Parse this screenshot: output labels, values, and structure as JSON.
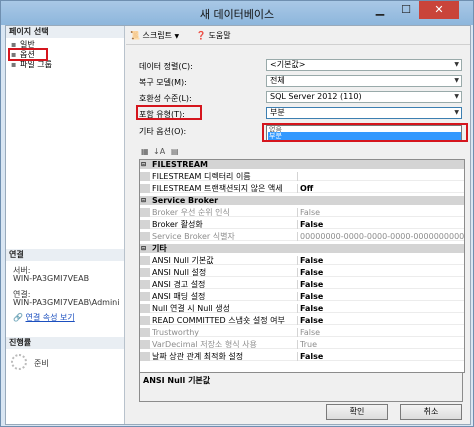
{
  "window": {
    "title": "새 데이터베이스"
  },
  "left_panel": {
    "pages_header": "페이지 선택",
    "pages": [
      {
        "label": "일반",
        "icon": "page-icon"
      },
      {
        "label": "옵션",
        "icon": "page-icon"
      },
      {
        "label": "파일 그룹",
        "icon": "page-icon"
      }
    ],
    "connection_header": "연결",
    "server_label": "서버:",
    "server_value": "WIN-PA3GMI7VEAB",
    "conn_label": "연결:",
    "conn_value": "WIN-PA3GMI7VEAB\\Admini",
    "conn_link": "연결 속성 보기",
    "progress_header": "진행률",
    "progress_status": "준비"
  },
  "toolbar": {
    "script_label": "스크립트",
    "help_label": "도움말"
  },
  "fields": [
    {
      "label": "데이터 정렬(C):",
      "value": "<기본값>"
    },
    {
      "label": "복구 모델(M):",
      "value": "전체"
    },
    {
      "label": "호환성 수준(L):",
      "value": "SQL Server 2012 (110)"
    },
    {
      "label": "포함 유형(T):",
      "value": "부분"
    },
    {
      "label": "기타 옵션(O):",
      "value": ""
    }
  ],
  "dropdown": {
    "options": [
      "없음",
      "부분"
    ],
    "selected": "부분"
  },
  "property_grid": {
    "rows": [
      {
        "type": "cat",
        "name": "FILESTREAM"
      },
      {
        "type": "prop",
        "name": "FILESTREAM 디렉터리 이름",
        "value": "",
        "disabled": false
      },
      {
        "type": "prop",
        "name": "FILESTREAM 트랜잭션되지 않은 액세",
        "value": "Off",
        "disabled": false
      },
      {
        "type": "cat",
        "name": "Service Broker"
      },
      {
        "type": "prop",
        "name": "Broker 우선 순위 인식",
        "value": "False",
        "disabled": true
      },
      {
        "type": "prop",
        "name": "Broker 활성화",
        "value": "False",
        "disabled": false
      },
      {
        "type": "prop",
        "name": "Service Broker 식별자",
        "value": "00000000-0000-0000-0000-000000000000",
        "disabled": true
      },
      {
        "type": "cat",
        "name": "기타"
      },
      {
        "type": "prop",
        "name": "ANSI Null 기본값",
        "value": "False",
        "disabled": false
      },
      {
        "type": "prop",
        "name": "ANSI Null 설정",
        "value": "False",
        "disabled": false
      },
      {
        "type": "prop",
        "name": "ANSI 경고 설정",
        "value": "False",
        "disabled": false
      },
      {
        "type": "prop",
        "name": "ANSI 패딩 설정",
        "value": "False",
        "disabled": false
      },
      {
        "type": "prop",
        "name": "Null 연결 시 Null 생성",
        "value": "False",
        "disabled": false
      },
      {
        "type": "prop",
        "name": "READ COMMITTED 스냅숏 설정 여부",
        "value": "False",
        "disabled": false
      },
      {
        "type": "prop",
        "name": "Trustworthy",
        "value": "False",
        "disabled": true
      },
      {
        "type": "prop",
        "name": "VarDecimal 저장소 형식 사용",
        "value": "True",
        "disabled": true
      },
      {
        "type": "prop",
        "name": "날짜 상관 관계 최적화 설정",
        "value": "False",
        "disabled": false
      }
    ]
  },
  "description": {
    "title": "ANSI Null 기본값"
  },
  "buttons": {
    "ok": "확인",
    "cancel": "취소"
  },
  "colors": {
    "highlight": "#3399ff",
    "annotation": "#d5151d"
  }
}
